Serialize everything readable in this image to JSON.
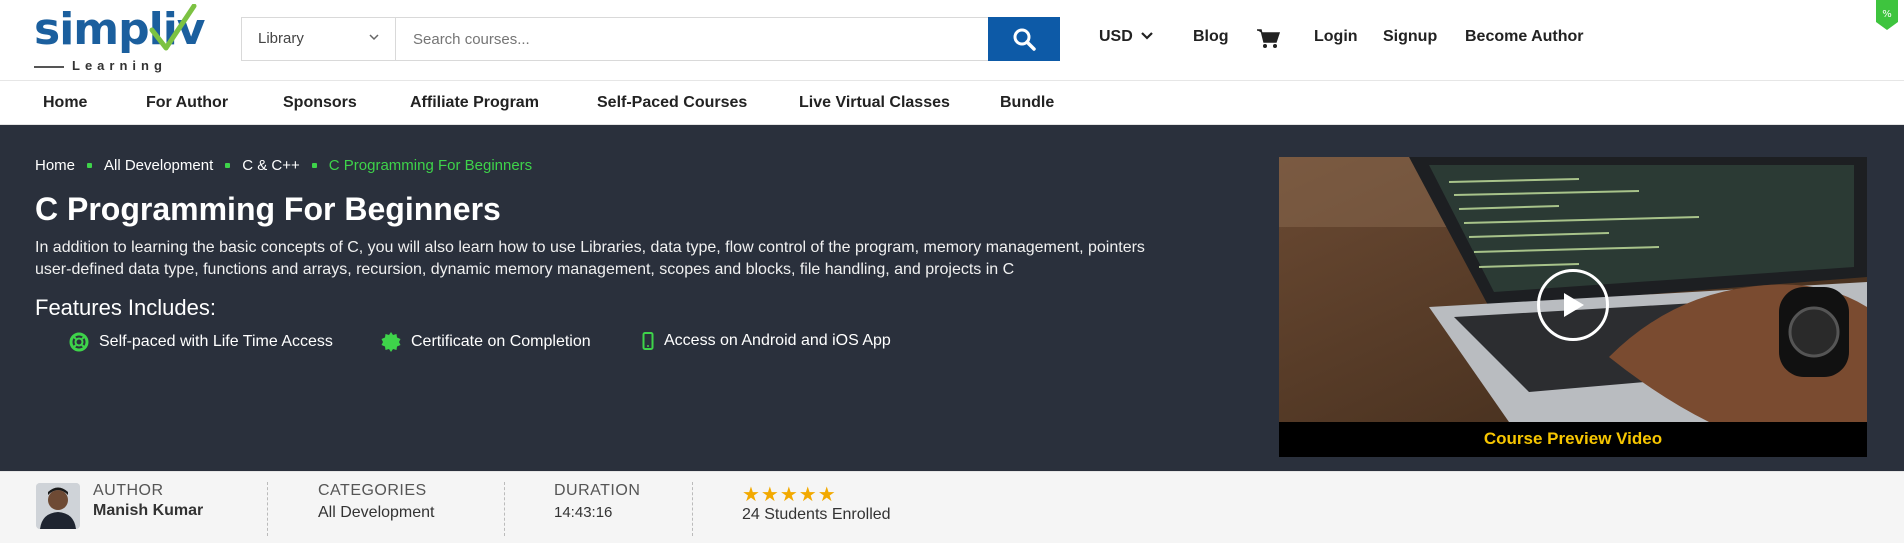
{
  "brand": {
    "logo_text": "simpliv",
    "logo_subtext": "Learning",
    "colors": {
      "primary": "#0d5aa7",
      "accent_green": "#3ed34a",
      "hero_bg": "#2a303c",
      "star": "#f2a900",
      "caption": "#f7c600"
    }
  },
  "header": {
    "category_select": "Library",
    "search_placeholder": "Search courses...",
    "currency": "USD",
    "links": {
      "blog": "Blog",
      "login": "Login",
      "signup": "Signup",
      "become_author": "Become Author"
    },
    "icons": {
      "search": "search-icon",
      "cart": "cart-icon",
      "dropdown": "chevron-down-icon",
      "promo": "discount-tag-icon"
    }
  },
  "menu": {
    "items": [
      "Home",
      "For Author",
      "Sponsors",
      "Affiliate Program",
      "Self-Paced Courses",
      "Live Virtual Classes",
      "Bundle"
    ]
  },
  "hero": {
    "breadcrumbs": [
      "Home",
      "All Development",
      "C & C++",
      "C Programming For Beginners"
    ],
    "title": "C Programming For Beginners",
    "description_line1": "In addition to learning the basic concepts of C, you will also learn how to use Libraries, data type, flow control of the program, memory management, pointers",
    "description_line2": "user-defined data type, functions and arrays, recursion, dynamic memory management, scopes and blocks, file handling, and projects in C",
    "features_title": "Features Includes:",
    "features": [
      {
        "label": "Self-paced with Life Time Access",
        "icon": "lifebuoy-icon"
      },
      {
        "label": "Certificate on Completion",
        "icon": "certificate-badge-icon"
      },
      {
        "label": "Access on Android and iOS App",
        "icon": "mobile-phone-icon"
      }
    ],
    "video_caption": "Course Preview Video"
  },
  "info": {
    "author_label": "AUTHOR",
    "author_name": "Manish Kumar",
    "categories_label": "CATEGORIES",
    "categories_value": "All Development",
    "duration_label": "DURATION",
    "duration_value": "14:43:16",
    "rating_stars": "★★★★★",
    "enrolled": "24 Students Enrolled"
  }
}
